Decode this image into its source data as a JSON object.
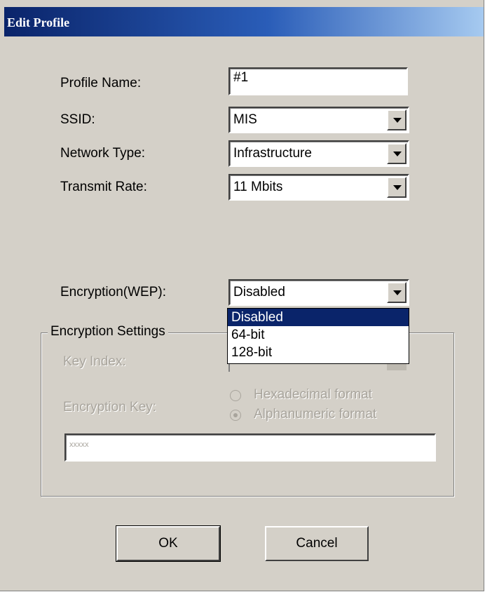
{
  "window": {
    "title": "Edit Profile"
  },
  "fields": {
    "profile_name": {
      "label": "Profile Name:",
      "value": "#1"
    },
    "ssid": {
      "label": "SSID:",
      "value": "MIS"
    },
    "network_type": {
      "label": "Network Type:",
      "value": "Infrastructure"
    },
    "transmit_rate": {
      "label": "Transmit Rate:",
      "value": "11 Mbits"
    },
    "encryption": {
      "label": "Encryption(WEP):",
      "value": "Disabled",
      "options": [
        "Disabled",
        "64-bit",
        "128-bit"
      ],
      "selected_option": "Disabled"
    }
  },
  "encryption_settings": {
    "title": "Encryption Settings",
    "key_index_label": "Key Index:",
    "encryption_key_label": "Encryption Key:",
    "hex_format_label": "Hexadecimal format",
    "alpha_format_label": "Alphanumeric format",
    "key_value": "xxxxx"
  },
  "buttons": {
    "ok": "OK",
    "cancel": "Cancel"
  },
  "colors": {
    "dialog_bg": "#d4d0c8",
    "titlebar_start": "#0a246a",
    "titlebar_end": "#a6caf0",
    "selection": "#0a246a"
  }
}
